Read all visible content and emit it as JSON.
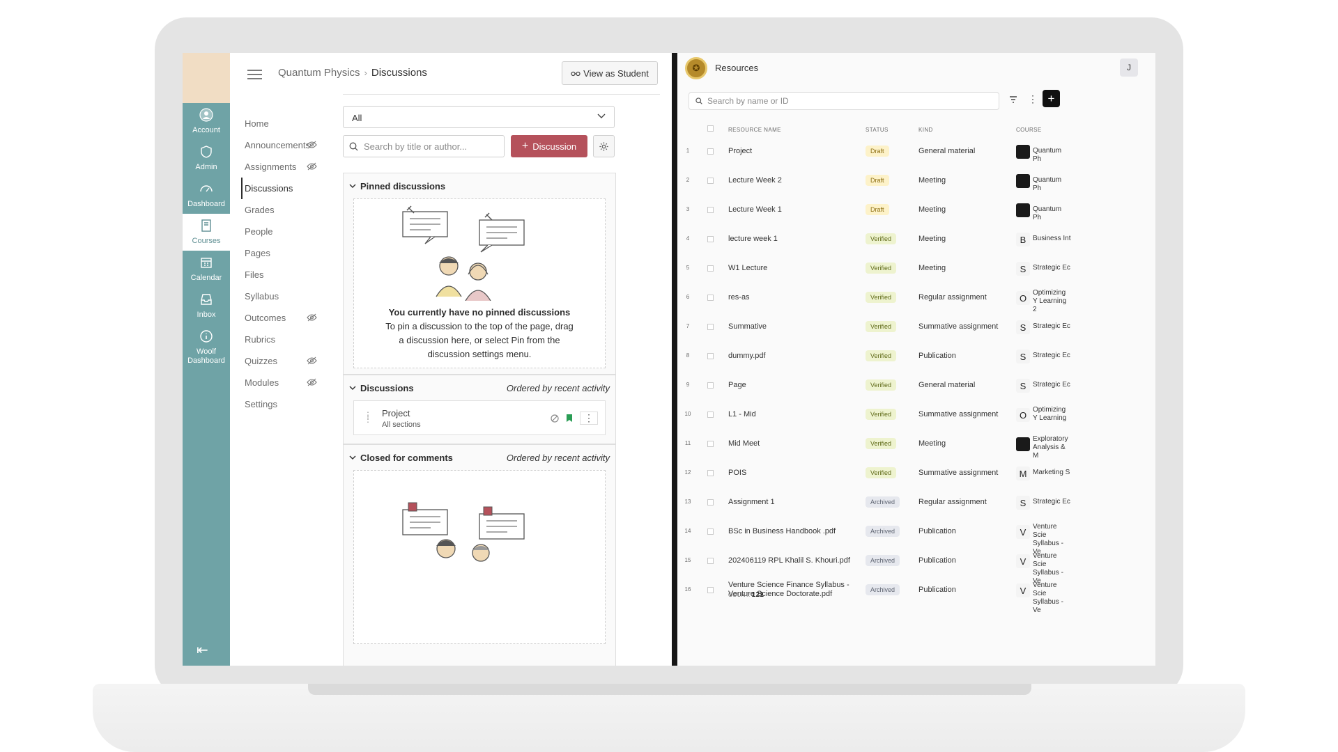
{
  "global_nav": [
    {
      "label": "Account",
      "icon": "account-icon"
    },
    {
      "label": "Admin",
      "icon": "shield-icon"
    },
    {
      "label": "Dashboard",
      "icon": "speedometer-icon"
    },
    {
      "label": "Courses",
      "icon": "book-icon",
      "active": true
    },
    {
      "label": "Calendar",
      "icon": "calendar-icon"
    },
    {
      "label": "Inbox",
      "icon": "inbox-icon"
    },
    {
      "label": "Woolf Dashboard",
      "icon": "info-icon"
    }
  ],
  "breadcrumb": {
    "course": "Quantum Physics",
    "separator": "›",
    "current": "Discussions"
  },
  "view_as_student": "View as Student",
  "course_nav": [
    {
      "label": "Home"
    },
    {
      "label": "Announcements",
      "hidden": true
    },
    {
      "label": "Assignments",
      "hidden": true
    },
    {
      "label": "Discussions",
      "active": true
    },
    {
      "label": "Grades"
    },
    {
      "label": "People"
    },
    {
      "label": "Pages"
    },
    {
      "label": "Files"
    },
    {
      "label": "Syllabus"
    },
    {
      "label": "Outcomes",
      "hidden": true
    },
    {
      "label": "Rubrics"
    },
    {
      "label": "Quizzes",
      "hidden": true
    },
    {
      "label": "Modules",
      "hidden": true
    },
    {
      "label": "Settings"
    }
  ],
  "discussions": {
    "filter_value": "All",
    "search_placeholder": "Search by title or author...",
    "add_label": "Discussion",
    "pinned": {
      "title": "Pinned discussions",
      "empty_title": "You currently have no pinned discussions",
      "empty_body": "To pin a discussion to the top of the page, drag a discussion here, or select Pin from the discussion settings menu."
    },
    "list": {
      "title": "Discussions",
      "order": "Ordered by recent activity",
      "items": [
        {
          "title": "Project",
          "sections": "All sections"
        }
      ]
    },
    "closed": {
      "title": "Closed for comments",
      "order": "Ordered by recent activity"
    }
  },
  "resources": {
    "title": "Resources",
    "avatar_initial": "J",
    "search_placeholder": "Search by name or ID",
    "columns": {
      "name": "RESOURCE NAME",
      "status": "STATUS",
      "kind": "KIND",
      "course": "COURSE"
    },
    "rows": [
      {
        "n": "1",
        "name": "Project",
        "status": "Draft",
        "kind": "General material",
        "course_icon": "",
        "course": "Quantum Ph"
      },
      {
        "n": "2",
        "name": "Lecture Week 2",
        "status": "Draft",
        "kind": "Meeting",
        "course_icon": "",
        "course": "Quantum Ph"
      },
      {
        "n": "3",
        "name": "Lecture Week 1",
        "status": "Draft",
        "kind": "Meeting",
        "course_icon": "",
        "course": "Quantum Ph"
      },
      {
        "n": "4",
        "name": "lecture week 1",
        "status": "Verified",
        "kind": "Meeting",
        "course_icon": "B",
        "course": "Business Int"
      },
      {
        "n": "5",
        "name": "W1 Lecture",
        "status": "Verified",
        "kind": "Meeting",
        "course_icon": "S",
        "course": "Strategic Ec"
      },
      {
        "n": "6",
        "name": "res-as",
        "status": "Verified",
        "kind": "Regular assignment",
        "course_icon": "O",
        "course": "Optimizing Y Learning 2"
      },
      {
        "n": "7",
        "name": "Summative",
        "status": "Verified",
        "kind": "Summative assignment",
        "course_icon": "S",
        "course": "Strategic Ec"
      },
      {
        "n": "8",
        "name": "dummy.pdf",
        "status": "Verified",
        "kind": "Publication",
        "course_icon": "S",
        "course": "Strategic Ec"
      },
      {
        "n": "9",
        "name": "Page",
        "status": "Verified",
        "kind": "General material",
        "course_icon": "S",
        "course": "Strategic Ec"
      },
      {
        "n": "10",
        "name": "L1 - Mid",
        "status": "Verified",
        "kind": "Summative assignment",
        "course_icon": "O",
        "course": "Optimizing Y Learning"
      },
      {
        "n": "11",
        "name": "Mid Meet",
        "status": "Verified",
        "kind": "Meeting",
        "course_icon": "",
        "course": "Exploratory Analysis & M"
      },
      {
        "n": "12",
        "name": "POIS",
        "status": "Verified",
        "kind": "Summative assignment",
        "course_icon": "M",
        "course": "Marketing S"
      },
      {
        "n": "13",
        "name": "Assignment 1",
        "status": "Archived",
        "kind": "Regular assignment",
        "course_icon": "S",
        "course": "Strategic Ec"
      },
      {
        "n": "14",
        "name": "BSc in Business Handbook .pdf",
        "status": "Archived",
        "kind": "Publication",
        "course_icon": "V",
        "course": "Venture Scie Syllabus - Ve"
      },
      {
        "n": "15",
        "name": "202406119 RPL Khalil S. Khouri.pdf",
        "status": "Archived",
        "kind": "Publication",
        "course_icon": "V",
        "course": "Venture Scie Syllabus - Ve"
      },
      {
        "n": "16",
        "name": "Venture Science Finance Syllabus - Venture Science Doctorate.pdf",
        "status": "Archived",
        "kind": "Publication",
        "course_icon": "V",
        "course": "Venture Scie Syllabus - Ve"
      }
    ],
    "count_label": "COUNT:",
    "count_value": "121"
  },
  "colors": {
    "nav_teal": "#6fa3a6",
    "discussion_button": "#b5515b",
    "divider": "#161616"
  }
}
